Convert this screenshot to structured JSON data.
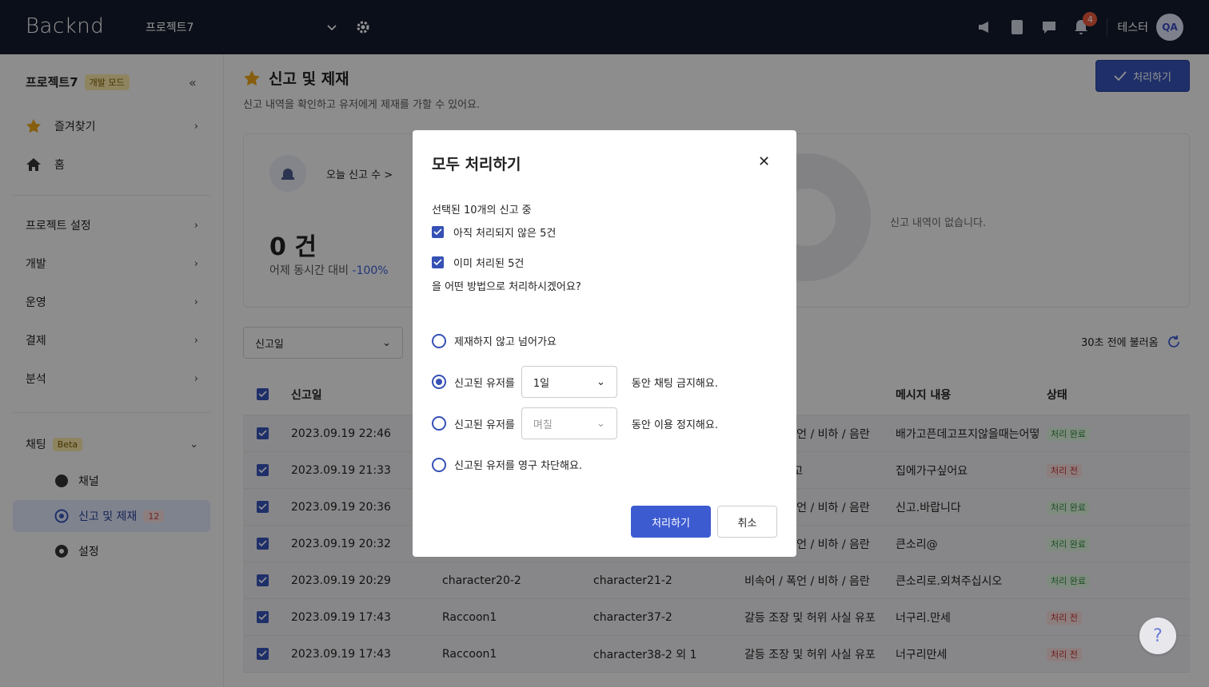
{
  "topbar": {
    "logo": "Backnd",
    "project": "프로젝트7",
    "notification_count": "4",
    "user_name": "테스터",
    "avatar_initials": "QA"
  },
  "sidebar": {
    "project_name": "프로젝트7",
    "mode_badge": "개발 모드",
    "favorites": "즐겨찾기",
    "home": "홈",
    "sections": [
      "프로젝트 설정",
      "개발",
      "운영",
      "결제",
      "분석"
    ],
    "chat": "채팅",
    "chat_badge": "Beta",
    "sub_channel": "채널",
    "sub_report": "신고 및 제재",
    "sub_report_count": "12",
    "sub_settings": "설정"
  },
  "page": {
    "title": "신고 및 제재",
    "description": "신고 내역을 확인하고 유저에게 제재를 가할 수 있어요.",
    "process_button": "처리하기"
  },
  "stats": {
    "label": "오늘 신고 수 >",
    "value": "0 건",
    "compare_label": "어제 동시간 대비",
    "compare_value": "-100%",
    "no_data": "신고 내역이 없습니다."
  },
  "filter": {
    "selected": "신고일",
    "refresh_text": "30초 전에 불러옴"
  },
  "table": {
    "headers": {
      "date": "신고일",
      "message": "메시지 내용",
      "status": "상태"
    },
    "rows": [
      {
        "date": "2023.09.19 22:46",
        "reporter": "",
        "target": "",
        "reason": "비속어 / 폭언 / 비하 / 음란",
        "message": "배가고픈데고프지않을때는어떻",
        "status": "처리 완료"
      },
      {
        "date": "2023.09.19 21:33",
        "reporter": "",
        "target": "",
        "reason": "도배 및 광고",
        "message": "집에가구싶어요",
        "status": "처리 전"
      },
      {
        "date": "2023.09.19 20:36",
        "reporter": "",
        "target": "",
        "reason": "비속어 / 폭언 / 비하 / 음란",
        "message": "신고.바랍니다",
        "status": "처리 완료"
      },
      {
        "date": "2023.09.19 20:32",
        "reporter": "",
        "target": "",
        "reason": "비속어 / 폭언 / 비하 / 음란",
        "message": "큰소리@",
        "status": "처리 완료"
      },
      {
        "date": "2023.09.19 20:29",
        "reporter": "character20-2",
        "target": "character21-2",
        "reason": "비속어 / 폭언 / 비하 / 음란",
        "message": "큰소리로.외쳐주십시오",
        "status": "처리 완료"
      },
      {
        "date": "2023.09.19 17:43",
        "reporter": "Raccoon1",
        "target": "character37-2",
        "reason": "갈등 조장 및 허위 사실 유포",
        "message": "너구리.만세",
        "status": "처리 전"
      },
      {
        "date": "2023.09.19 17:43",
        "reporter": "Raccoon1",
        "target": "character38-2 외 1",
        "reason": "갈등 조장 및 허위 사실 유포",
        "message": "너구리만세",
        "status": "처리 전"
      }
    ]
  },
  "modal": {
    "title": "모두 처리하기",
    "intro": "선택된 10개의 신고 중",
    "check_unprocessed": "아직 처리되지 않은 5건",
    "check_processed": "이미 처리된 5건",
    "question": "을 어떤 방법으로 처리하시겠어요?",
    "opt_skip": "제재하지 않고 넘어가요",
    "opt_chat_prefix": "신고된 유저를",
    "opt_chat_value": "1일",
    "opt_chat_suffix": "동안 채팅 금지해요.",
    "opt_suspend_prefix": "신고된 유저를",
    "opt_suspend_placeholder": "며칠",
    "opt_suspend_suffix": "동안 이용 정지해요.",
    "opt_ban": "신고된 유저를 영구 차단해요.",
    "confirm": "처리하기",
    "cancel": "취소"
  },
  "help": "?"
}
